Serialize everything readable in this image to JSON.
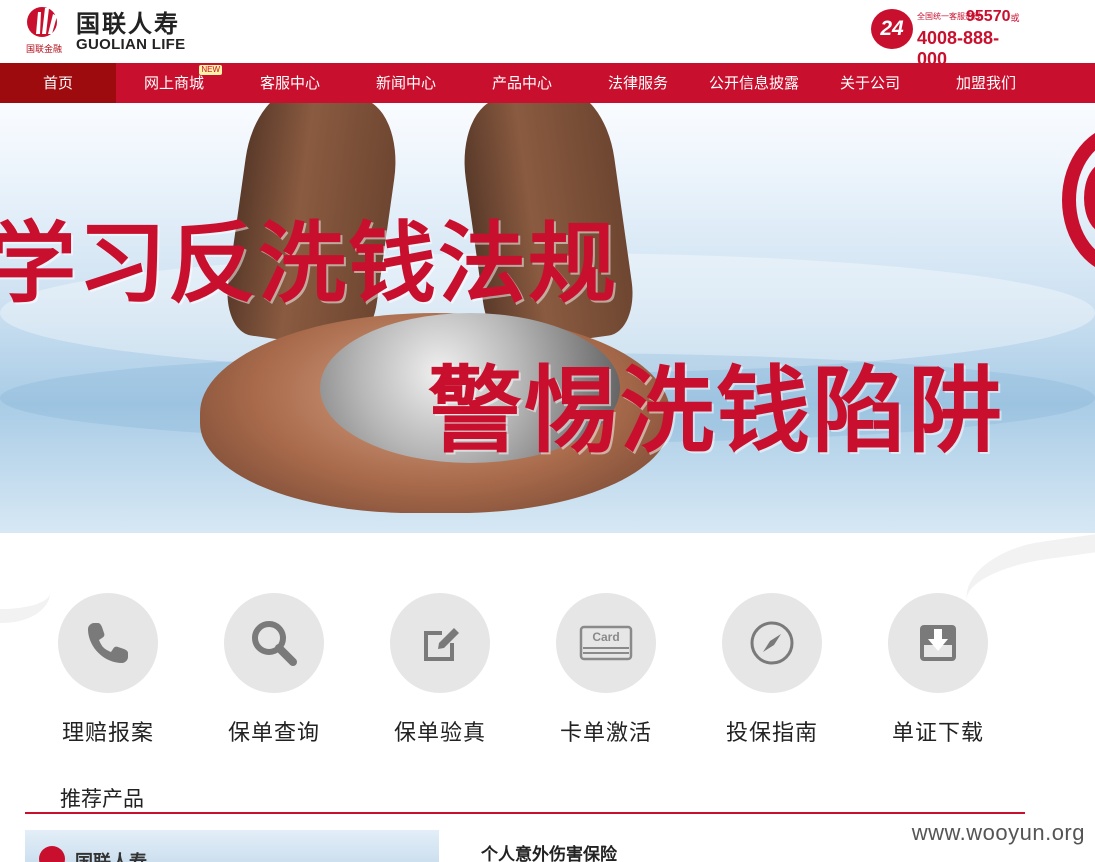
{
  "header": {
    "logo_cn": "国联人寿",
    "logo_en": "GUOLIAN LIFE",
    "logo_sub": "国联金融",
    "hotline_badge": "24",
    "hotline_small": "全国统一客服热线",
    "hotline_primary": "95570",
    "hotline_or": "或",
    "hotline_secondary": "4008-888-000"
  },
  "nav": {
    "items": [
      {
        "label": "首页",
        "active": true
      },
      {
        "label": "网上商城",
        "badge": "NEW"
      },
      {
        "label": "客服中心"
      },
      {
        "label": "新闻中心"
      },
      {
        "label": "产品中心"
      },
      {
        "label": "法律服务"
      },
      {
        "label": "公开信息披露"
      },
      {
        "label": "关于公司"
      },
      {
        "label": "加盟我们"
      }
    ]
  },
  "banner": {
    "line1": "学习反洗钱法规",
    "line2": "警惕洗钱陷阱"
  },
  "services": [
    {
      "label": "理赔报案",
      "icon": "phone-icon"
    },
    {
      "label": "保单查询",
      "icon": "search-icon"
    },
    {
      "label": "保单验真",
      "icon": "edit-icon"
    },
    {
      "label": "卡单激活",
      "icon": "card-icon",
      "icon_text": "Card"
    },
    {
      "label": "投保指南",
      "icon": "compass-icon"
    },
    {
      "label": "单证下载",
      "icon": "download-icon"
    }
  ],
  "recommended": {
    "title": "推荐产品",
    "thumb_text": "国联人寿",
    "product_name": "个人意外伤害保险"
  },
  "watermark": "www.wooyun.org",
  "colors": {
    "brand_red": "#c8102e",
    "nav_active": "#9e0b0f",
    "icon_circle": "#e6e6e6",
    "icon_glyph": "#7a7a7a"
  }
}
